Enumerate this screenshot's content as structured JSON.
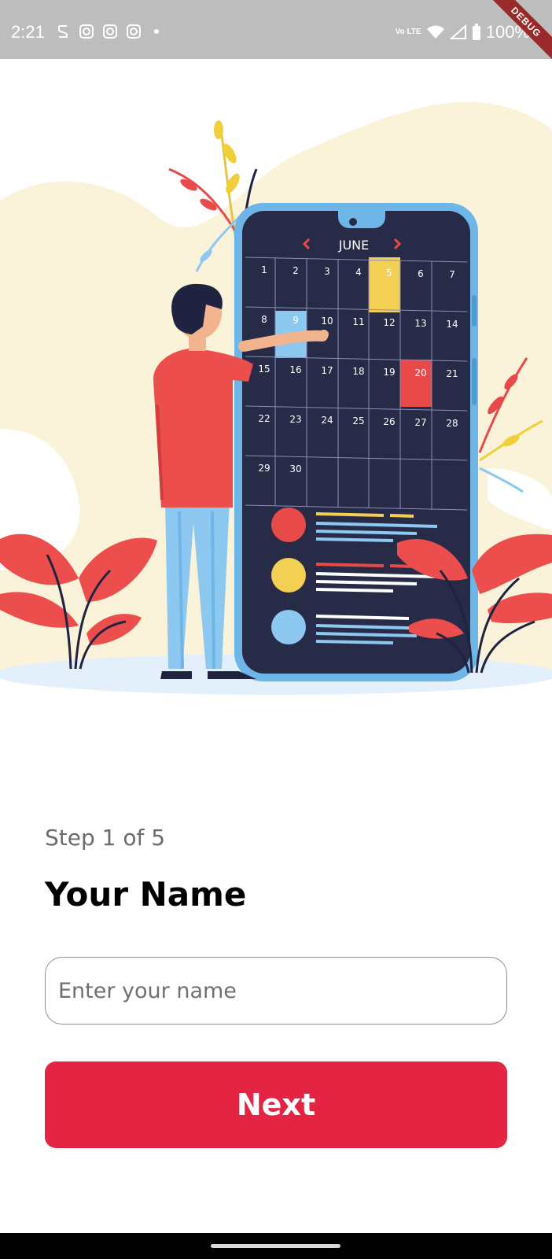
{
  "status_bar": {
    "time": "2:21",
    "battery": "100%",
    "network_label": "Vo LTE",
    "debug_label": "DEBUG"
  },
  "illustration": {
    "calendar_month": "JUNE",
    "days": [
      "1",
      "2",
      "3",
      "4",
      "5",
      "6",
      "7",
      "8",
      "9",
      "10",
      "11",
      "12",
      "13",
      "14",
      "15",
      "16",
      "17",
      "18",
      "19",
      "20",
      "21",
      "22",
      "23",
      "24",
      "25",
      "26",
      "27",
      "28",
      "29",
      "30"
    ],
    "highlight_colors": {
      "yellow": "#f3cf53",
      "blue": "#8cc8f0",
      "red": "#e84a4a"
    }
  },
  "onboarding": {
    "step_text": "Step 1 of 5",
    "title": "Your Name",
    "name_placeholder": "Enter your name",
    "name_value": "",
    "next_label": "Next"
  },
  "colors": {
    "accent": "#e32443",
    "status_bar": "#bdbdbd"
  }
}
